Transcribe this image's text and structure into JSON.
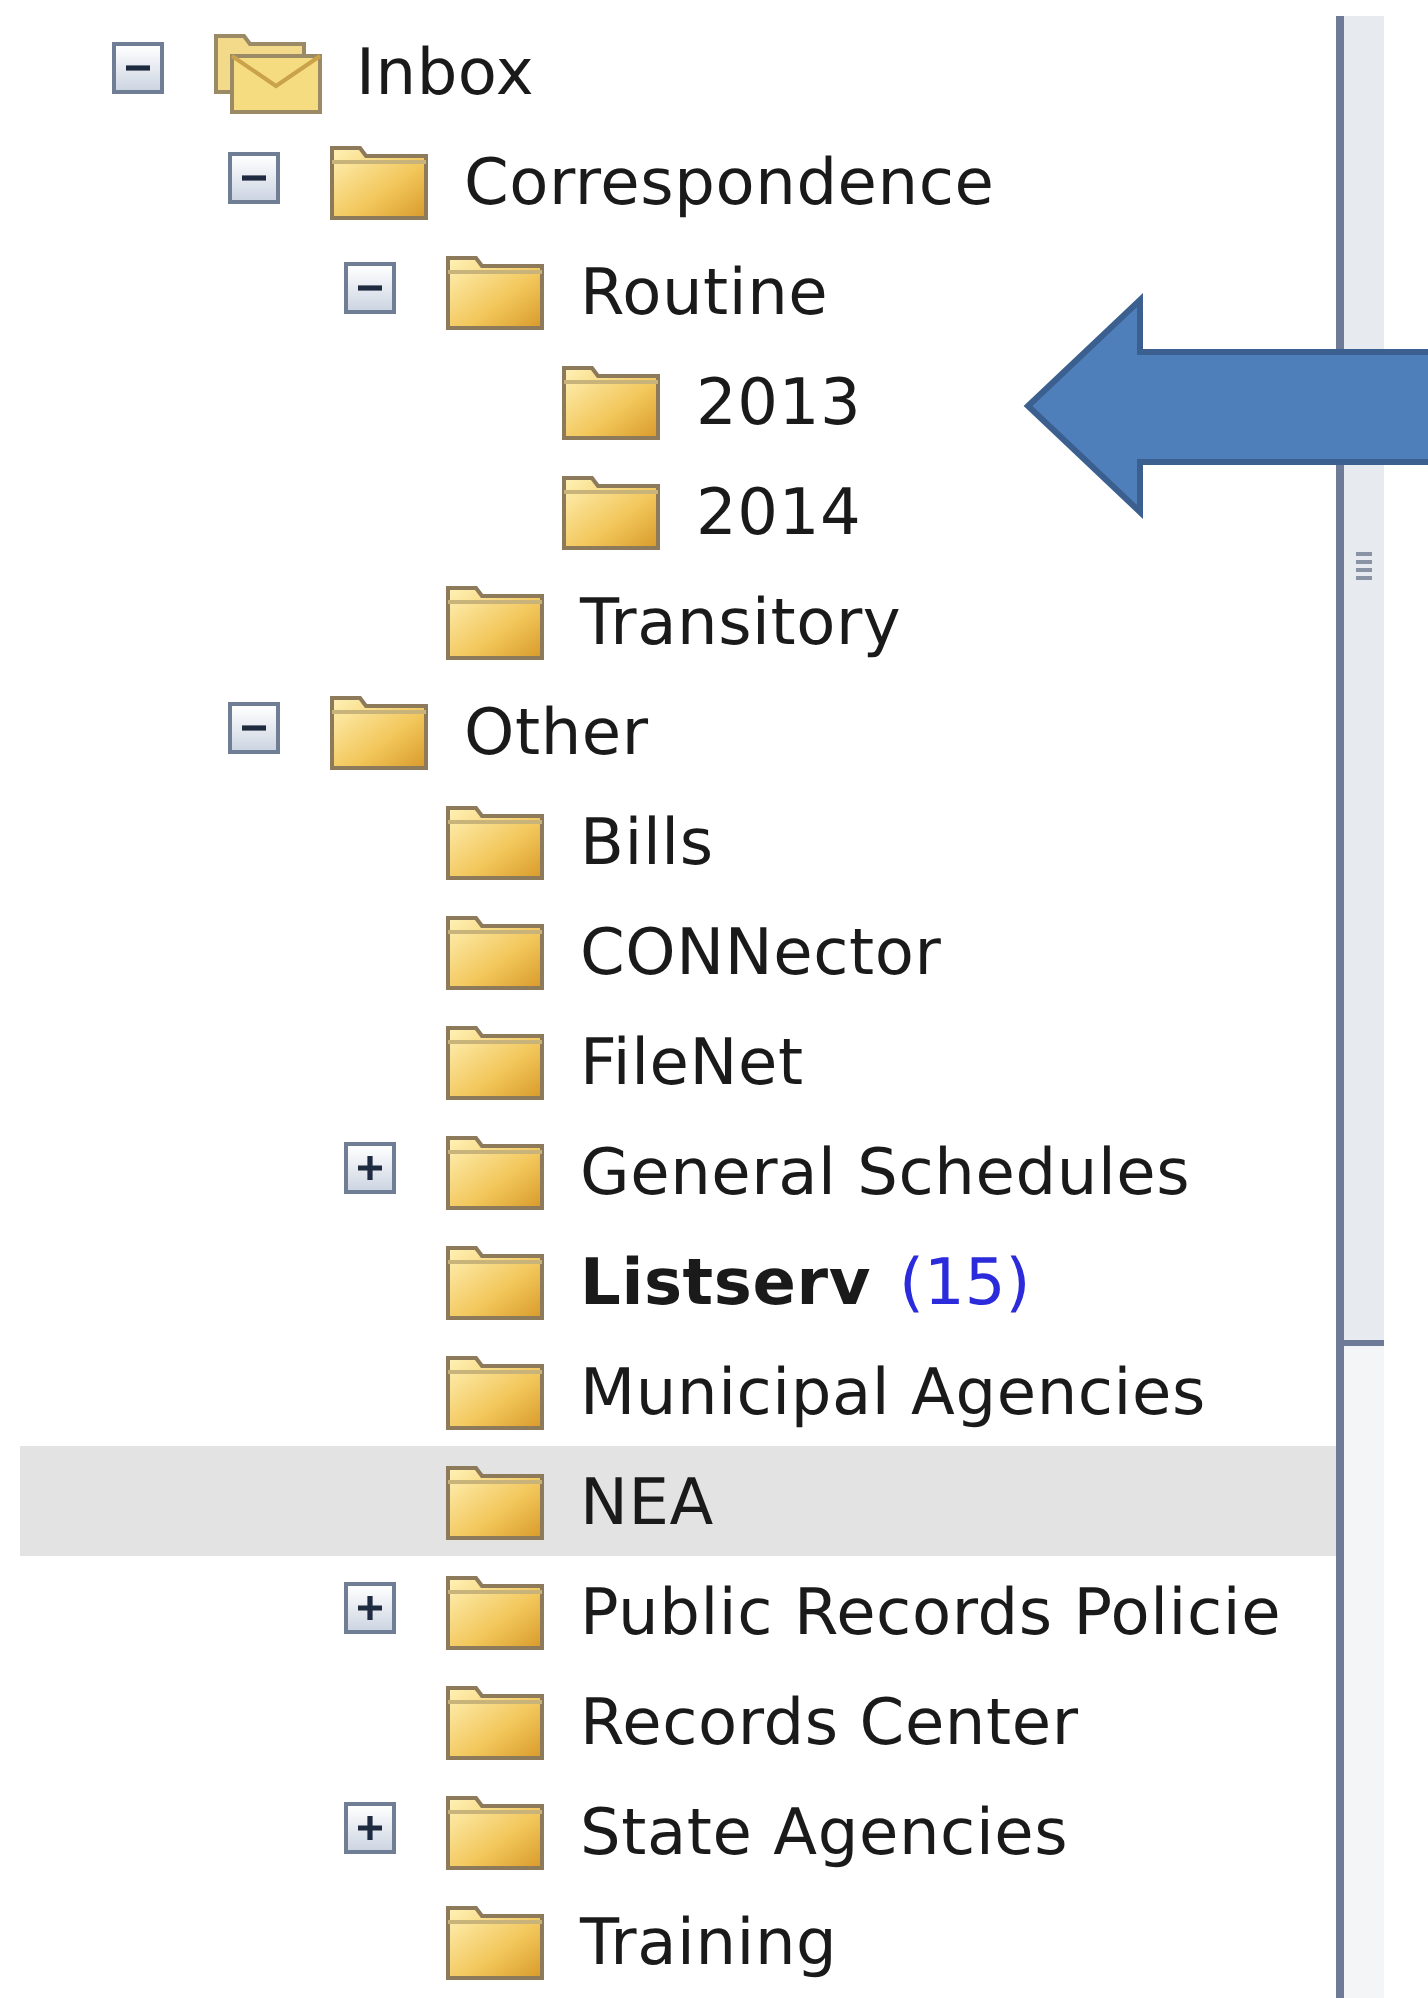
{
  "folders": [
    {
      "label": "Inbox",
      "kind": "inbox",
      "expanded": true,
      "selected": false,
      "children": [
        {
          "label": "Correspondence",
          "kind": "folder",
          "expanded": true,
          "selected": false,
          "children": [
            {
              "label": "Routine",
              "kind": "folder",
              "expanded": true,
              "selected": false,
              "children": [
                {
                  "label": "2013",
                  "kind": "folder",
                  "selected": false
                },
                {
                  "label": "2014",
                  "kind": "folder",
                  "selected": false
                }
              ]
            },
            {
              "label": "Transitory",
              "kind": "folder",
              "selected": false
            }
          ]
        },
        {
          "label": "Other",
          "kind": "folder",
          "expanded": true,
          "selected": false,
          "children": [
            {
              "label": "Bills",
              "kind": "folder",
              "selected": false
            },
            {
              "label": "CONNector",
              "kind": "folder",
              "selected": false
            },
            {
              "label": "FileNet",
              "kind": "folder",
              "selected": false
            },
            {
              "label": "General Schedules",
              "kind": "folder",
              "expanded": false,
              "selected": false
            },
            {
              "label": "Listserv",
              "kind": "folder",
              "bold": true,
              "count": "(15)",
              "selected": false
            },
            {
              "label": "Municipal Agencies",
              "kind": "folder",
              "selected": false
            },
            {
              "label": "NEA",
              "kind": "folder",
              "selected": true
            },
            {
              "label": "Public Records Policie",
              "kind": "folder",
              "expanded": false,
              "selected": false
            },
            {
              "label": "Records Center",
              "kind": "folder",
              "selected": false
            },
            {
              "label": "State Agencies",
              "kind": "folder",
              "expanded": false,
              "selected": false
            },
            {
              "label": "Training",
              "kind": "folder",
              "selected": false
            }
          ]
        }
      ]
    }
  ]
}
